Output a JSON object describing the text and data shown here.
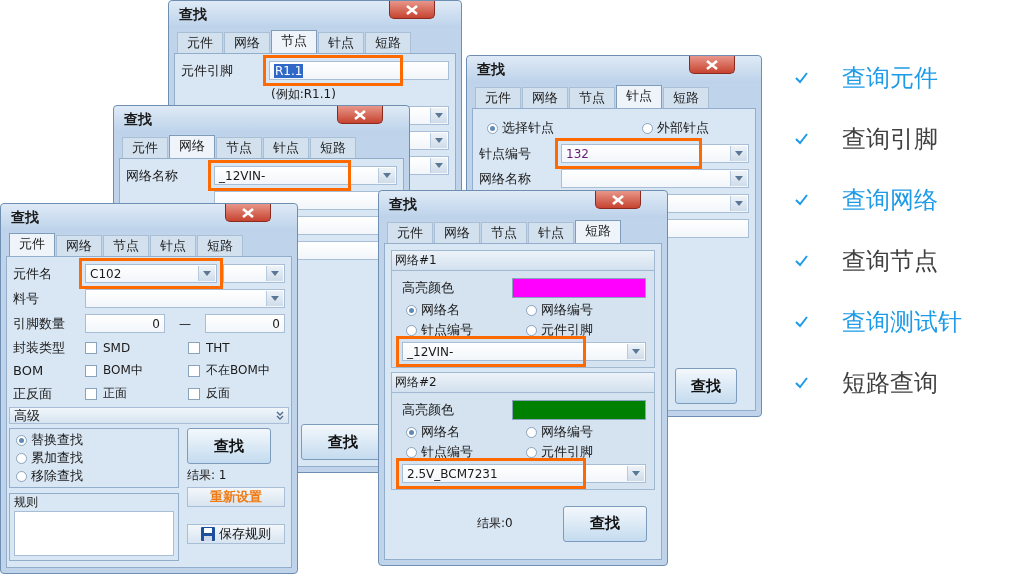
{
  "windows": [
    {
      "kind": "node",
      "title": "查找",
      "tabs": [
        {
          "label": "元件",
          "selected": false
        },
        {
          "label": "网络",
          "selected": false
        },
        {
          "label": "节点",
          "selected": true
        },
        {
          "label": "针点",
          "selected": false
        },
        {
          "label": "短路",
          "selected": false
        }
      ],
      "pin_field": {
        "label": "元件引脚",
        "value": "R1.1",
        "text_selected": true,
        "highlighted": true
      },
      "hint": "(例如:R1.1)"
    },
    {
      "kind": "net",
      "title": "查找",
      "tabs": [
        {
          "label": "元件",
          "selected": false
        },
        {
          "label": "网络",
          "selected": true
        },
        {
          "label": "节点",
          "selected": false
        },
        {
          "label": "针点",
          "selected": false
        },
        {
          "label": "短路",
          "selected": false
        }
      ],
      "net_name": {
        "label": "网络名称",
        "value": "_12VIN-",
        "highlighted": true
      },
      "find_button": "查找"
    },
    {
      "kind": "pin",
      "title": "查找",
      "tabs": [
        {
          "label": "元件",
          "selected": false
        },
        {
          "label": "网络",
          "selected": false
        },
        {
          "label": "节点",
          "selected": false
        },
        {
          "label": "针点",
          "selected": true
        },
        {
          "label": "短路",
          "selected": false
        }
      ],
      "pin_type": [
        {
          "label": "选择针点",
          "selected": true
        },
        {
          "label": "外部针点",
          "selected": false
        }
      ],
      "pin_number": {
        "label": "针点编号",
        "value": "132",
        "highlighted": true
      },
      "net_name": {
        "label": "网络名称"
      },
      "find_button": "查找"
    },
    {
      "kind": "component",
      "title": "查找",
      "tabs": [
        {
          "label": "元件",
          "selected": true
        },
        {
          "label": "网络",
          "selected": false
        },
        {
          "label": "节点",
          "selected": false
        },
        {
          "label": "针点",
          "selected": false
        },
        {
          "label": "短路",
          "selected": false
        }
      ],
      "name_row": {
        "label": "元件名",
        "value": "C102",
        "highlighted": true
      },
      "part_row": {
        "label": "料号"
      },
      "pin_count": {
        "label": "引脚数量",
        "from": "0",
        "separator": "—",
        "to": "0"
      },
      "filters": [
        {
          "label": "封装类型",
          "options": [
            {
              "label": "SMD",
              "checked": false
            },
            {
              "label": "THT",
              "checked": false
            }
          ]
        },
        {
          "label": "BOM",
          "options": [
            {
              "label": "BOM中",
              "checked": false
            },
            {
              "label": "不在BOM中",
              "checked": false
            }
          ]
        },
        {
          "label": "正反面",
          "options": [
            {
              "label": "正面",
              "checked": false
            },
            {
              "label": "反面",
              "checked": false
            }
          ]
        }
      ],
      "advanced": {
        "label": "高级",
        "expanded": false
      },
      "modes": [
        {
          "label": "替换查找",
          "selected": true
        },
        {
          "label": "累加查找",
          "selected": false
        },
        {
          "label": "移除查找",
          "selected": false
        }
      ],
      "find_button": "查找",
      "result": "结果: 1",
      "reset_button": "重新设置",
      "rules_label": "规则",
      "save_button": "保存规则"
    },
    {
      "kind": "short",
      "title": "查找",
      "tabs": [
        {
          "label": "元件",
          "selected": false
        },
        {
          "label": "网络",
          "selected": false
        },
        {
          "label": "节点",
          "selected": false
        },
        {
          "label": "针点",
          "selected": false
        },
        {
          "label": "短路",
          "selected": true
        }
      ],
      "nets": [
        {
          "heading": "网络#1",
          "color_label": "高亮颜色",
          "color": "#ff00ff",
          "modes": [
            {
              "label": "网络名",
              "selected": true
            },
            {
              "label": "网络编号",
              "selected": false
            },
            {
              "label": "针点编号",
              "selected": false
            },
            {
              "label": "元件引脚",
              "selected": false
            }
          ],
          "value": "_12VIN-",
          "highlighted": true
        },
        {
          "heading": "网络#2",
          "color_label": "高亮颜色",
          "color": "#008000",
          "modes": [
            {
              "label": "网络名",
              "selected": true
            },
            {
              "label": "网络编号",
              "selected": false
            },
            {
              "label": "针点编号",
              "selected": false
            },
            {
              "label": "元件引脚",
              "selected": false
            }
          ],
          "value": "2.5V_BCM7231",
          "highlighted": true
        }
      ],
      "result": "结果:0",
      "find_button": "查找"
    }
  ],
  "features": [
    {
      "label": "查询元件",
      "color": "#1e9be8"
    },
    {
      "label": "查询引脚",
      "color": "#404040"
    },
    {
      "label": "查询网络",
      "color": "#1e9be8"
    },
    {
      "label": "查询节点",
      "color": "#404040"
    },
    {
      "label": "查询测试针",
      "color": "#1e9be8"
    },
    {
      "label": "短路查询",
      "color": "#404040"
    }
  ]
}
